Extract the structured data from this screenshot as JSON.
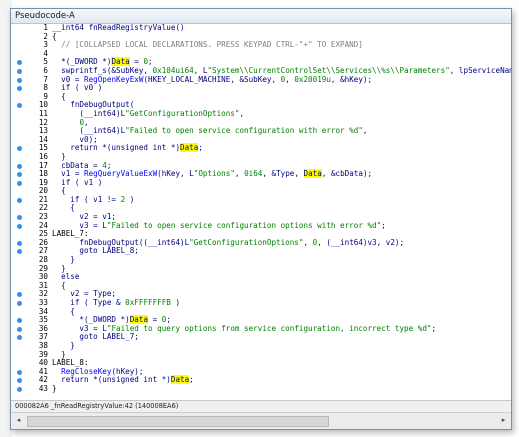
{
  "window": {
    "title": "Pseudocode-A"
  },
  "status": {
    "text": "000082A6 _fnReadRegistryValue:42 (140008EA6)"
  },
  "code_lines": [
    {
      "n": "1",
      "dot": false,
      "parts": [
        [
          "kw",
          "__int64 fnReadRegistryValue()"
        ]
      ]
    },
    {
      "n": "2",
      "dot": false,
      "parts": [
        [
          "lbl",
          "{"
        ]
      ]
    },
    {
      "n": "3",
      "dot": false,
      "parts": [
        [
          "cm",
          "  // [COLLAPSED LOCAL DECLARATIONS. PRESS KEYPAD CTRL-\"+\" TO EXPAND]"
        ]
      ]
    },
    {
      "n": "4",
      "dot": false,
      "parts": []
    },
    {
      "n": "5",
      "dot": true,
      "parts": [
        [
          "kw",
          "  *(_DWORD *)"
        ],
        [
          "hl",
          "Data"
        ],
        [
          "kw",
          " = "
        ],
        [
          "num",
          "0"
        ],
        [
          "kw",
          ";"
        ]
      ]
    },
    {
      "n": "6",
      "dot": true,
      "parts": [
        [
          "kw",
          "  swprintf_s(&SubKey, "
        ],
        [
          "num",
          "0x104ui64"
        ],
        [
          "kw",
          ", L"
        ],
        [
          "st",
          "\"System\\\\CurrentControlSet\\\\Services\\\\%s\\\\Parameters\""
        ],
        [
          "kw",
          ", lpServiceName);"
        ]
      ]
    },
    {
      "n": "7",
      "dot": true,
      "parts": [
        [
          "kw",
          "  v0 = "
        ],
        [
          "fn",
          "RegOpenKeyExW"
        ],
        [
          "kw",
          "(HKEY_LOCAL_MACHINE, &SubKey, "
        ],
        [
          "num",
          "0"
        ],
        [
          "kw",
          ", "
        ],
        [
          "num",
          "0x20019u"
        ],
        [
          "kw",
          ", &hKey);"
        ]
      ]
    },
    {
      "n": "8",
      "dot": true,
      "parts": [
        [
          "kw",
          "  if ( v0 )"
        ]
      ]
    },
    {
      "n": "9",
      "dot": false,
      "parts": [
        [
          "kw",
          "  {"
        ]
      ]
    },
    {
      "n": "10",
      "dot": true,
      "parts": [
        [
          "kw",
          "    fnDebugOutput("
        ]
      ]
    },
    {
      "n": "11",
      "dot": false,
      "parts": [
        [
          "kw",
          "      (__int64)L"
        ],
        [
          "st",
          "\"GetConfigurationOptions\""
        ],
        [
          "kw",
          ","
        ]
      ]
    },
    {
      "n": "12",
      "dot": false,
      "parts": [
        [
          "kw",
          "      "
        ],
        [
          "num",
          "0"
        ],
        [
          "kw",
          ","
        ]
      ]
    },
    {
      "n": "13",
      "dot": false,
      "parts": [
        [
          "kw",
          "      (__int64)L"
        ],
        [
          "st",
          "\"Failed to open service configuration with error %d\""
        ],
        [
          "kw",
          ","
        ]
      ]
    },
    {
      "n": "14",
      "dot": false,
      "parts": [
        [
          "kw",
          "      v0);"
        ]
      ]
    },
    {
      "n": "15",
      "dot": true,
      "parts": [
        [
          "kw",
          "    return *(unsigned int *)"
        ],
        [
          "hl",
          "Data"
        ],
        [
          "kw",
          ";"
        ]
      ]
    },
    {
      "n": "16",
      "dot": false,
      "parts": [
        [
          "kw",
          "  }"
        ]
      ]
    },
    {
      "n": "17",
      "dot": true,
      "parts": [
        [
          "kw",
          "  cbData = "
        ],
        [
          "num",
          "4"
        ],
        [
          "kw",
          ";"
        ]
      ]
    },
    {
      "n": "18",
      "dot": true,
      "parts": [
        [
          "kw",
          "  v1 = "
        ],
        [
          "fn",
          "RegQueryValueExW"
        ],
        [
          "kw",
          "(hKey, L"
        ],
        [
          "st",
          "\"Options\""
        ],
        [
          "kw",
          ", "
        ],
        [
          "num",
          "0i64"
        ],
        [
          "kw",
          ", &Type, "
        ],
        [
          "hl",
          "Data"
        ],
        [
          "kw",
          ", &cbData);"
        ]
      ]
    },
    {
      "n": "19",
      "dot": true,
      "parts": [
        [
          "kw",
          "  if ( v1 )"
        ]
      ]
    },
    {
      "n": "20",
      "dot": false,
      "parts": [
        [
          "kw",
          "  {"
        ]
      ]
    },
    {
      "n": "21",
      "dot": true,
      "parts": [
        [
          "kw",
          "    if ( v1 != "
        ],
        [
          "num",
          "2"
        ],
        [
          "kw",
          " )"
        ]
      ]
    },
    {
      "n": "22",
      "dot": false,
      "parts": [
        [
          "kw",
          "    {"
        ]
      ]
    },
    {
      "n": "23",
      "dot": true,
      "parts": [
        [
          "kw",
          "      v2 = v1;"
        ]
      ]
    },
    {
      "n": "24",
      "dot": true,
      "parts": [
        [
          "kw",
          "      v3 = L"
        ],
        [
          "st",
          "\"Failed to open service configuration options with error %d\""
        ],
        [
          "kw",
          ";"
        ]
      ]
    },
    {
      "n": "25",
      "dot": false,
      "parts": [
        [
          "lbl",
          "LABEL_7:"
        ]
      ]
    },
    {
      "n": "26",
      "dot": true,
      "parts": [
        [
          "kw",
          "      fnDebugOutput((__int64)L"
        ],
        [
          "st",
          "\"GetConfigurationOptions\""
        ],
        [
          "kw",
          ", "
        ],
        [
          "num",
          "0"
        ],
        [
          "kw",
          ", (__int64)v3, v2);"
        ]
      ]
    },
    {
      "n": "27",
      "dot": true,
      "parts": [
        [
          "kw",
          "      goto LABEL_8;"
        ]
      ]
    },
    {
      "n": "28",
      "dot": false,
      "parts": [
        [
          "kw",
          "    }"
        ]
      ]
    },
    {
      "n": "29",
      "dot": false,
      "parts": [
        [
          "kw",
          "  }"
        ]
      ]
    },
    {
      "n": "30",
      "dot": false,
      "parts": [
        [
          "kw",
          "  else"
        ]
      ]
    },
    {
      "n": "31",
      "dot": false,
      "parts": [
        [
          "kw",
          "  {"
        ]
      ]
    },
    {
      "n": "32",
      "dot": true,
      "parts": [
        [
          "kw",
          "    v2 = Type;"
        ]
      ]
    },
    {
      "n": "33",
      "dot": true,
      "parts": [
        [
          "kw",
          "    if ( Type & "
        ],
        [
          "num",
          "0xFFFFFFFB"
        ],
        [
          "kw",
          " )"
        ]
      ]
    },
    {
      "n": "34",
      "dot": false,
      "parts": [
        [
          "kw",
          "    {"
        ]
      ]
    },
    {
      "n": "35",
      "dot": true,
      "parts": [
        [
          "kw",
          "      *(_DWORD *)"
        ],
        [
          "hl",
          "Data"
        ],
        [
          "kw",
          " = "
        ],
        [
          "num",
          "0"
        ],
        [
          "kw",
          ";"
        ]
      ]
    },
    {
      "n": "36",
      "dot": true,
      "parts": [
        [
          "kw",
          "      v3 = L"
        ],
        [
          "st",
          "\"Failed to query options from service configuration, incorrect type %d\""
        ],
        [
          "kw",
          ";"
        ]
      ]
    },
    {
      "n": "37",
      "dot": true,
      "parts": [
        [
          "kw",
          "      goto LABEL_7;"
        ]
      ]
    },
    {
      "n": "38",
      "dot": false,
      "parts": [
        [
          "kw",
          "    }"
        ]
      ]
    },
    {
      "n": "39",
      "dot": false,
      "parts": [
        [
          "kw",
          "  }"
        ]
      ]
    },
    {
      "n": "40",
      "dot": false,
      "parts": [
        [
          "lbl",
          "LABEL_8:"
        ]
      ]
    },
    {
      "n": "41",
      "dot": true,
      "parts": [
        [
          "kw",
          "  "
        ],
        [
          "fn",
          "RegCloseKey"
        ],
        [
          "kw",
          "(hKey);"
        ]
      ]
    },
    {
      "n": "42",
      "dot": true,
      "parts": [
        [
          "kw",
          "  return *(unsigned int *)"
        ],
        [
          "hl",
          "Data"
        ],
        [
          "kw",
          ";"
        ]
      ]
    },
    {
      "n": "43",
      "dot": true,
      "parts": [
        [
          "lbl",
          "}"
        ]
      ]
    }
  ],
  "scrollbar": {
    "left_arrow": "◂",
    "right_arrow": "▸"
  }
}
